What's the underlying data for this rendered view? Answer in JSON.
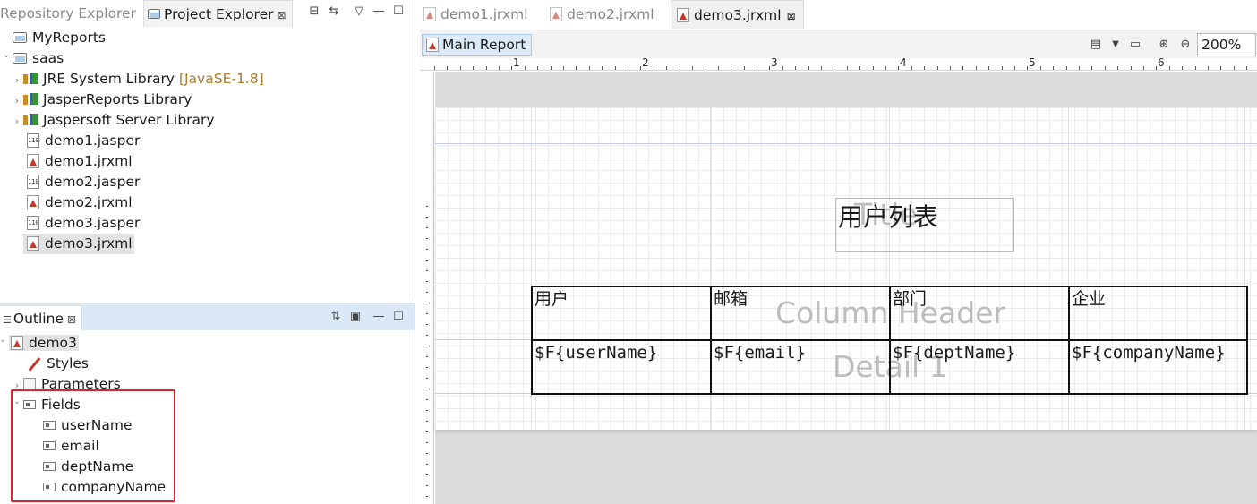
{
  "left_panel": {
    "tabs": [
      {
        "label": "Repository Explorer",
        "active": false
      },
      {
        "label": "Project Explorer",
        "active": true
      }
    ],
    "close_glyph": "⊠",
    "tree": [
      {
        "label": "MyReports",
        "icon": "folder-icon",
        "level": 0
      },
      {
        "label": "saas",
        "icon": "folder-icon",
        "level": 0
      },
      {
        "label": "JRE System Library",
        "suffix": "[JavaSE-1.8]",
        "icon": "library-icon",
        "level": 1
      },
      {
        "label": "JasperReports Library",
        "icon": "library-icon",
        "level": 1
      },
      {
        "label": "Jaspersoft Server Library",
        "icon": "library-icon",
        "level": 1
      },
      {
        "label": "demo1.jasper",
        "icon": "jasper-file-icon",
        "level": 1
      },
      {
        "label": "demo1.jrxml",
        "icon": "jrxml-file-icon",
        "level": 1
      },
      {
        "label": "demo2.jasper",
        "icon": "jasper-file-icon",
        "level": 1
      },
      {
        "label": "demo2.jrxml",
        "icon": "jrxml-file-icon",
        "level": 1
      },
      {
        "label": "demo3.jasper",
        "icon": "jasper-file-icon",
        "level": 1
      },
      {
        "label": "demo3.jrxml",
        "icon": "jrxml-file-icon",
        "level": 1,
        "selected": true
      }
    ]
  },
  "outline": {
    "tab_label": "Outline",
    "tree": [
      {
        "label": "demo3",
        "icon": "report-icon"
      },
      {
        "label": "Styles",
        "icon": "styles-icon"
      },
      {
        "label": "Parameters",
        "icon": "parameters-icon"
      },
      {
        "label": "Fields",
        "icon": "fields-icon"
      },
      {
        "label": "userName",
        "icon": "field-icon"
      },
      {
        "label": "email",
        "icon": "field-icon"
      },
      {
        "label": "deptName",
        "icon": "field-icon"
      },
      {
        "label": "companyName",
        "icon": "field-icon"
      }
    ],
    "highlight_color": "#e0242b"
  },
  "editor": {
    "tabs": [
      {
        "label": "demo1.jrxml",
        "active": false
      },
      {
        "label": "demo2.jrxml",
        "active": false
      },
      {
        "label": "demo3.jrxml",
        "active": true
      }
    ],
    "main_report_label": "Main Report",
    "zoom": "200%",
    "ruler_numbers": [
      "1",
      "2",
      "3",
      "4",
      "5",
      "6"
    ],
    "report": {
      "title_text": "用户列表",
      "band_title": "Title",
      "band_column_header": "Column Header",
      "band_detail": "Detail 1",
      "headers": [
        "用户",
        "邮箱",
        "部门",
        "企业"
      ],
      "fields": [
        "$F{userName}",
        "$F{email}",
        "$F{deptName}",
        "$F{companyName}"
      ]
    }
  }
}
